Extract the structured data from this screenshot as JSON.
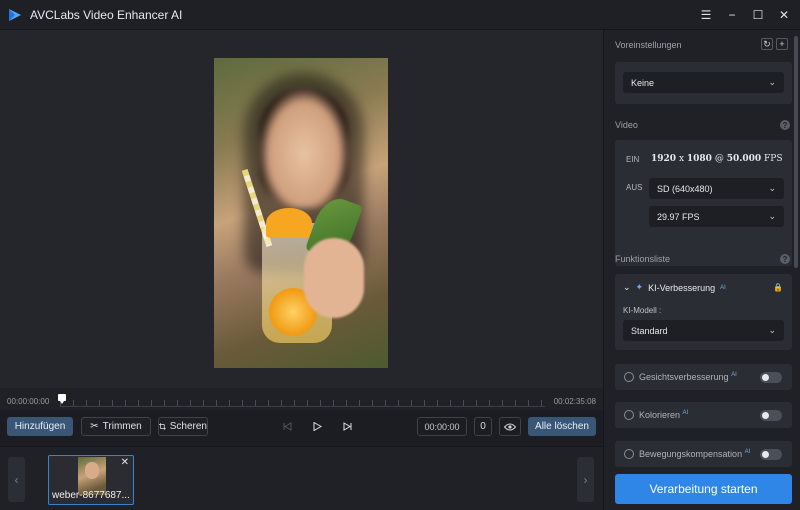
{
  "app": {
    "title": "AVCLabs Video Enhancer AI"
  },
  "timeline": {
    "start": "00:00:00:00",
    "end": "00:02:35:08"
  },
  "toolbar": {
    "add": "Hinzufügen",
    "trim": "Trimmen",
    "crop": "Scheren",
    "timecode": "00:00:00",
    "frame": "0",
    "clear": "Alle löschen"
  },
  "filmstrip": {
    "file_name": "weber-8677687..."
  },
  "sidebar": {
    "presets_label": "Voreinstellungen",
    "preset_value": "Keine",
    "video_label": "Video",
    "ein_label": "EIN",
    "ein_res": "1920",
    "ein_x": "x",
    "ein_h": "1080",
    "ein_at": "@",
    "ein_fps_val": "50.000",
    "ein_fps_unit": "FPS",
    "aus_label": "AUS",
    "aus_resolution": "SD (640x480)",
    "aus_fps": "29.97 FPS",
    "functions_label": "Funktionsliste",
    "ki_title": "KI-Verbesserung",
    "ai_tag": "AI",
    "model_label": "KI-Modell :",
    "model_value": "Standard",
    "face": "Gesichtsverbesserung",
    "color": "Kolorieren",
    "motion": "Bewegungskompensation",
    "start": "Verarbeitung starten"
  },
  "colors": {
    "accent": "#2f86e6",
    "primary_btn": "#3a5676",
    "selected_border": "#3b82d6"
  }
}
